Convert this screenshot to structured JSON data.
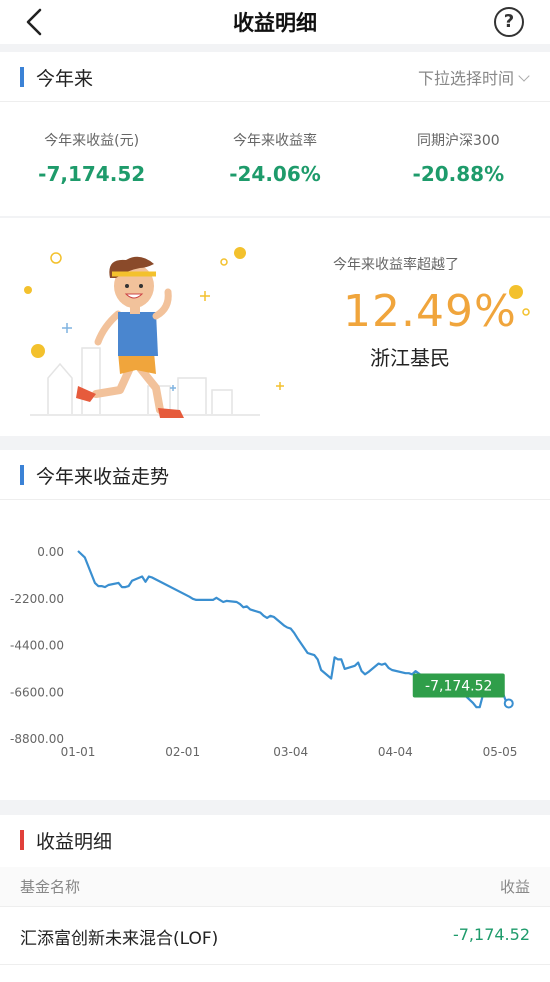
{
  "header": {
    "title": "收益明细",
    "back_icon": "chevron-left-icon",
    "help_icon": "question-circle-icon",
    "help_glyph": "?"
  },
  "summary": {
    "section_title": "今年来",
    "time_picker_label": "下拉选择时间",
    "stats": [
      {
        "label": "今年来收益(元)",
        "value": "-7,174.52"
      },
      {
        "label": "今年来收益率",
        "value": "-24.06%"
      },
      {
        "label": "同期沪深300",
        "value": "-20.88%"
      }
    ]
  },
  "ranking": {
    "caption": "今年来收益率超越了",
    "percent": "12.49%",
    "area": "浙江基民"
  },
  "trend": {
    "section_title": "今年来收益走势",
    "current_label": "-7,174.52"
  },
  "chart_data": {
    "type": "line",
    "ylim": [
      -8800,
      0
    ],
    "y_ticks": [
      "0.00",
      "-2200.00",
      "-4400.00",
      "-6600.00",
      "-8800.00"
    ],
    "x_ticks": [
      "01-01",
      "02-01",
      "03-04",
      "04-04",
      "05-05"
    ],
    "x_tick_dates": [
      "2020-01-01",
      "2020-02-01",
      "2020-03-04",
      "2020-04-04",
      "2020-05-05"
    ],
    "series": [
      {
        "color": "#3a8fd0",
        "x": [
          "2020-01-01",
          "2020-01-03",
          "2020-01-06",
          "2020-01-07",
          "2020-01-08",
          "2020-01-09",
          "2020-01-10",
          "2020-01-13",
          "2020-01-14",
          "2020-01-15",
          "2020-01-16",
          "2020-01-17",
          "2020-01-20",
          "2020-01-21",
          "2020-01-22",
          "2020-01-23",
          "2020-02-03",
          "2020-02-04",
          "2020-02-05",
          "2020-02-06",
          "2020-02-07",
          "2020-02-10",
          "2020-02-11",
          "2020-02-12",
          "2020-02-13",
          "2020-02-14",
          "2020-02-17",
          "2020-02-18",
          "2020-02-19",
          "2020-02-20",
          "2020-02-21",
          "2020-02-24",
          "2020-02-25",
          "2020-02-26",
          "2020-02-27",
          "2020-02-28",
          "2020-03-02",
          "2020-03-03",
          "2020-03-04",
          "2020-03-05",
          "2020-03-06",
          "2020-03-09",
          "2020-03-10",
          "2020-03-11",
          "2020-03-12",
          "2020-03-13",
          "2020-03-16",
          "2020-03-17",
          "2020-03-18",
          "2020-03-19",
          "2020-03-20",
          "2020-03-23",
          "2020-03-24",
          "2020-03-25",
          "2020-03-26",
          "2020-03-27",
          "2020-03-30",
          "2020-03-31",
          "2020-04-01",
          "2020-04-02",
          "2020-04-03",
          "2020-04-07",
          "2020-04-08",
          "2020-04-09",
          "2020-04-10",
          "2020-04-13",
          "2020-04-14",
          "2020-04-15",
          "2020-04-16",
          "2020-04-17",
          "2020-04-20",
          "2020-04-21",
          "2020-04-22",
          "2020-04-23",
          "2020-04-24",
          "2020-04-27",
          "2020-04-28",
          "2020-04-29",
          "2020-04-30",
          "2020-05-06",
          "2020-05-07"
        ],
        "y": [
          0,
          -300,
          -1500,
          -1650,
          -1650,
          -1700,
          -1600,
          -1500,
          -1700,
          -1700,
          -1650,
          -1400,
          -1200,
          -1450,
          -1200,
          -1250,
          -2150,
          -2250,
          -2300,
          -2300,
          -2300,
          -2300,
          -2200,
          -2300,
          -2400,
          -2350,
          -2400,
          -2500,
          -2650,
          -2600,
          -2750,
          -2900,
          -3050,
          -3150,
          -3050,
          -3100,
          -3500,
          -3600,
          -3650,
          -3850,
          -4100,
          -4800,
          -4850,
          -4900,
          -5100,
          -5600,
          -6000,
          -5000,
          -5100,
          -5100,
          -5550,
          -5400,
          -5250,
          -5650,
          -5800,
          -5700,
          -5300,
          -5350,
          -5300,
          -5500,
          -5600,
          -5750,
          -5750,
          -5800,
          -5650,
          -6000,
          -6150,
          -6150,
          -6300,
          -6200,
          -6300,
          -6300,
          -6200,
          -6300,
          -6700,
          -7150,
          -7350,
          -7350,
          -6750,
          -6750,
          -7174.52
        ]
      }
    ],
    "grid": false,
    "current_value": -7174.52
  },
  "detail": {
    "section_title": "收益明细",
    "col_name": "基金名称",
    "col_profit": "收益",
    "rows": [
      {
        "name": "汇添富创新未来混合(LOF)",
        "profit": "-7,174.52"
      }
    ]
  }
}
